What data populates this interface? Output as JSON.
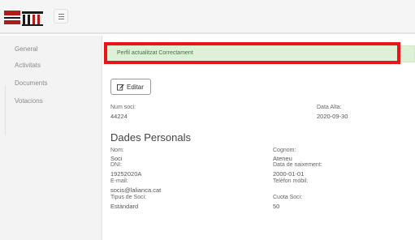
{
  "header": {
    "logo_text": "UNIÓ LLIBERTÀRIA"
  },
  "sidebar": {
    "items": [
      {
        "label": "General"
      },
      {
        "label": "Activitats"
      },
      {
        "label": "Documents"
      },
      {
        "label": "Votacions"
      }
    ]
  },
  "alert": {
    "message": "Perfil actualitzat Correctament"
  },
  "toolbar": {
    "edit_label": "Editar"
  },
  "membership": {
    "num_soci_label": "Num soci:",
    "num_soci_value": "44224",
    "data_alta_label": "Data Alta:",
    "data_alta_value": "2020-09-30"
  },
  "personal": {
    "heading": "Dades Personals",
    "nom_label": "Nom:",
    "nom_value": "Soci",
    "cognom_label": "Cognom:",
    "cognom_value": "Ateneu",
    "dni_label": "DNI:",
    "dni_value": "19252020A",
    "naixement_label": "Data de naixement:",
    "naixement_value": "2000-01-01",
    "email_label": "E-mail:",
    "email_value": "socis@lalianca.cat",
    "telefon_label": "Telèfon mòbil:",
    "tipus_label": "Tipus de Soci:",
    "tipus_value": "Estàndard",
    "quota_label": "Cuota Soci:",
    "quota_value": "50"
  },
  "colors": {
    "alert_bg": "#dff0d8",
    "highlight": "#e8141a",
    "logo_red": "#b21a1a"
  }
}
